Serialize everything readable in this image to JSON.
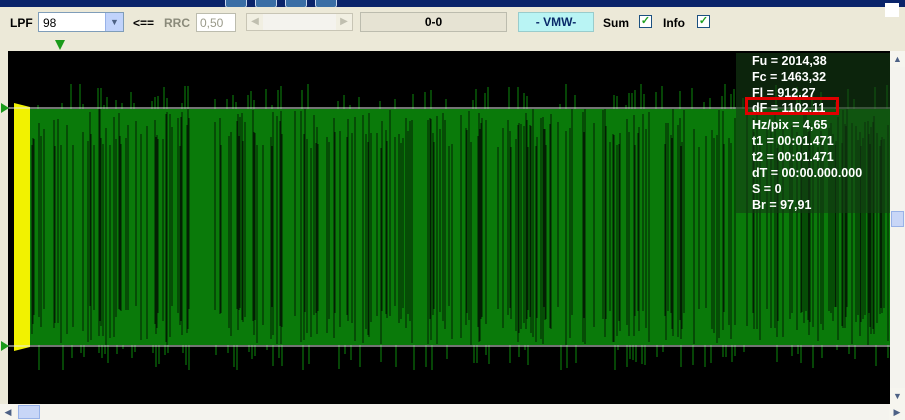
{
  "toolbar": {
    "lpf_label": "LPF",
    "lpf_value": "98",
    "arrow_label": "<==",
    "rrc_label": "RRC",
    "rrc_value": "0,50",
    "range_readout": "0-0",
    "mode_readout": "- VMW-",
    "sum_label": "Sum",
    "sum_checked": true,
    "info_label": "Info",
    "info_checked": true
  },
  "colors": {
    "signal": "#0a7a0a",
    "envelope": "#f2f200",
    "mode_bg": "#b9f4f4",
    "highlight": "#e00000"
  },
  "info_panel": {
    "fu": "Fu = 2014,38",
    "fc": "Fc = 1463,32",
    "fl": "Fl = 912,27",
    "df": "dF = 1102,11",
    "hz_pix": "Hz/pix = 4,65",
    "t1": "t1 = 00:01.471",
    "t2": "t2 = 00:01.471",
    "dt": "dT = 00:00.000.000",
    "s": "S = 0",
    "br": "Br = 97,91"
  },
  "icons": {
    "dropdown": "chevron-down-icon",
    "scroll_left": "arrow-left-icon",
    "scroll_right": "arrow-right-icon",
    "scroll_up": "arrow-up-icon",
    "scroll_down": "arrow-down-icon",
    "marker": "triangle-marker-icon"
  }
}
